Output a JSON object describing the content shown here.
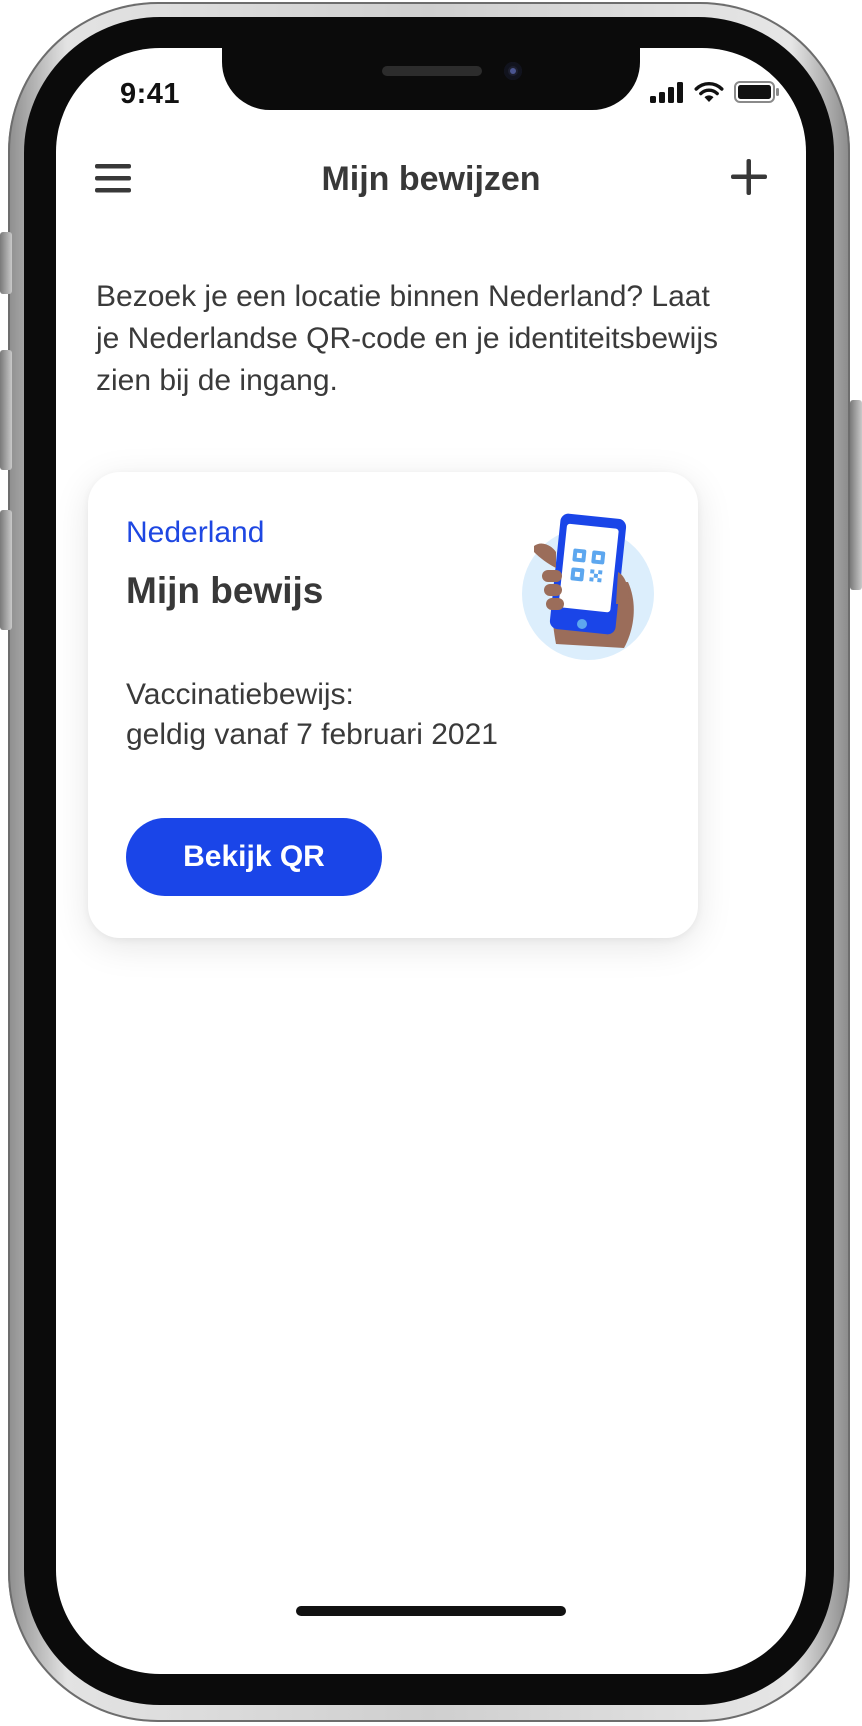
{
  "status_bar": {
    "time": "9:41",
    "signal_icon": "cellular-signal-icon",
    "wifi_icon": "wifi-icon",
    "battery_icon": "battery-icon"
  },
  "header": {
    "title": "Mijn bewijzen",
    "menu_icon": "hamburger-menu-icon",
    "add_icon": "plus-icon"
  },
  "intro_text": "Bezoek je een locatie binnen Nederland? Laat je Nederlandse QR-code en je identiteitsbewijs zien bij de ingang.",
  "card": {
    "country": "Nederland",
    "title": "Mijn bewijs",
    "description_line1": "Vaccinatiebewijs:",
    "description_line2": "geldig vanaf 7 februari 2021",
    "button_label": "Bekijk QR",
    "illustration": "hand-holding-phone-qr-icon"
  },
  "colors": {
    "accent_blue": "#1a45e8",
    "country_blue": "#1e47e2",
    "text_dark": "#383838",
    "illustration_bg": "#dceefc",
    "skin": "#9b6d5a"
  }
}
